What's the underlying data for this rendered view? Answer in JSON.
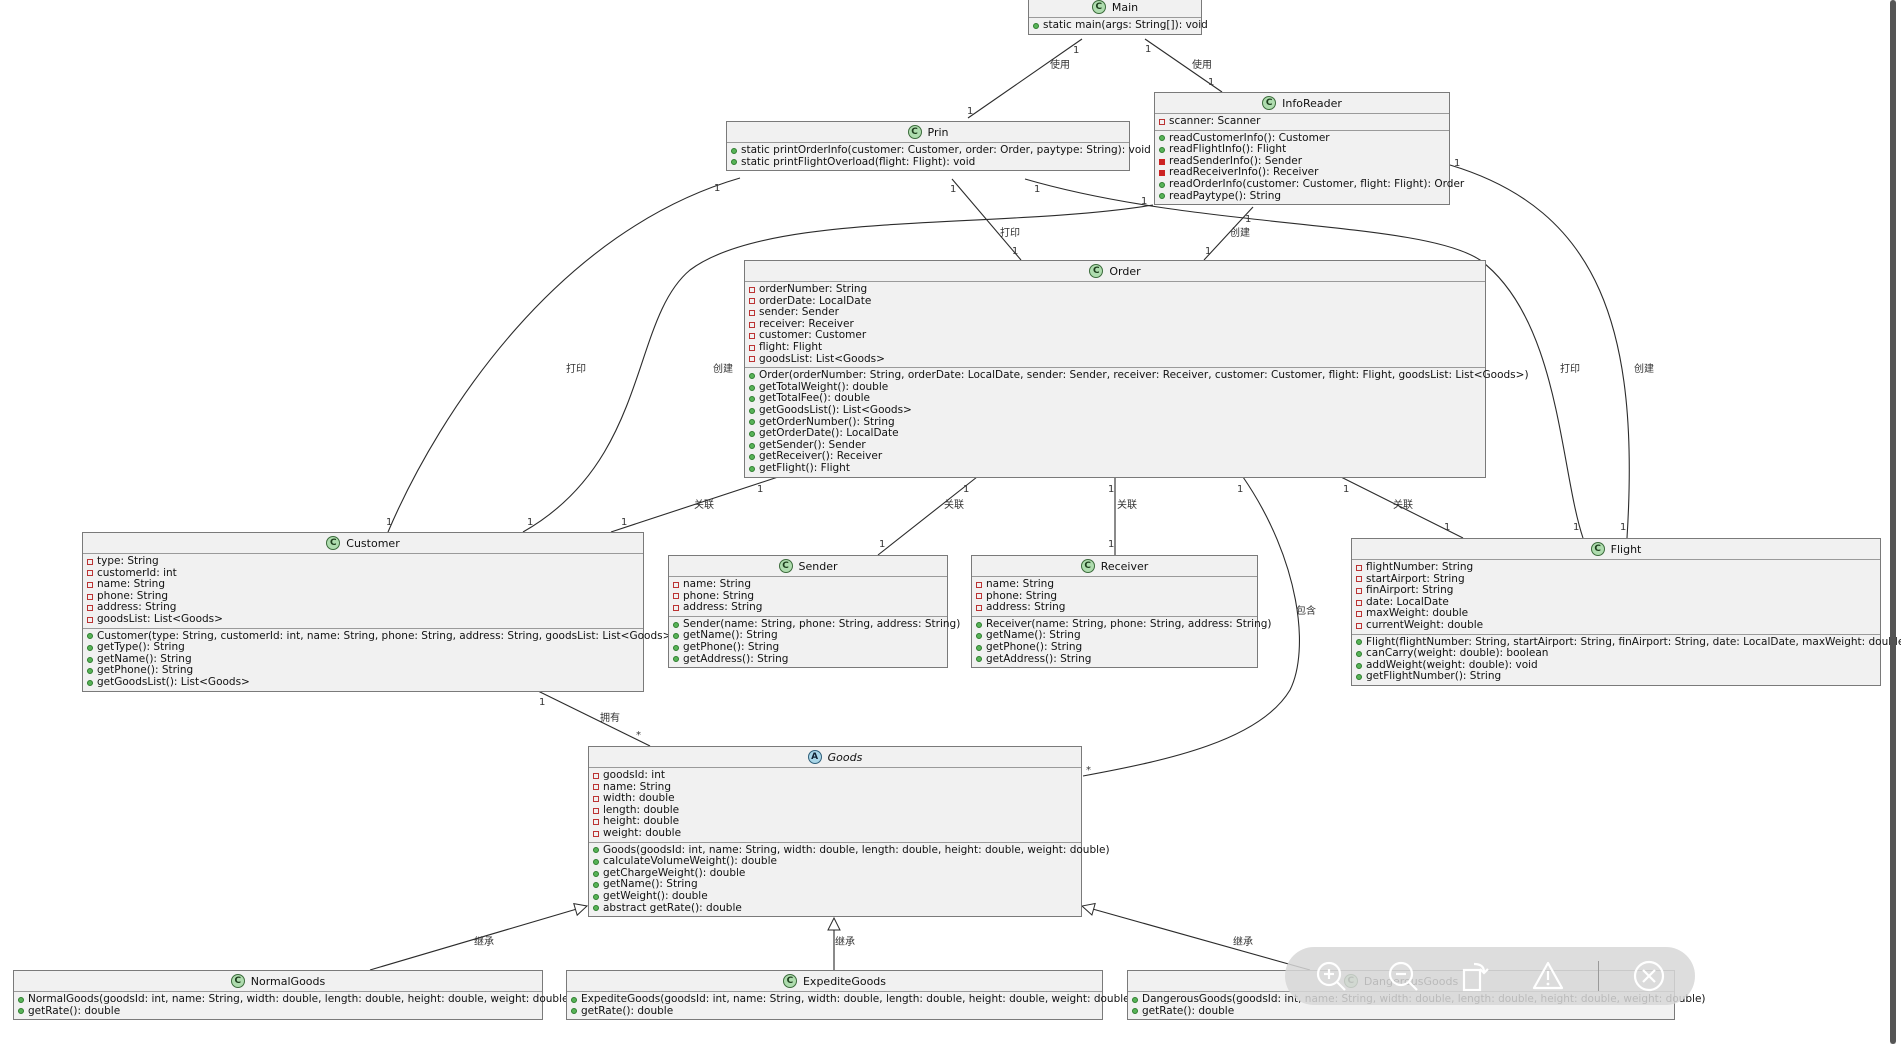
{
  "classes": {
    "main": {
      "name": "Main",
      "stereo": "C",
      "attributes": [],
      "methods": [
        {
          "v": "pub",
          "t": "static main(args: String[]): void"
        }
      ]
    },
    "infoReader": {
      "name": "InfoReader",
      "stereo": "C",
      "attributes": [
        {
          "v": "priv",
          "t": "scanner: Scanner"
        }
      ],
      "methods": [
        {
          "v": "pub",
          "t": "readCustomerInfo(): Customer"
        },
        {
          "v": "pub",
          "t": "readFlightInfo(): Flight"
        },
        {
          "v": "privm",
          "t": "readSenderInfo(): Sender"
        },
        {
          "v": "privm",
          "t": "readReceiverInfo(): Receiver"
        },
        {
          "v": "pub",
          "t": "readOrderInfo(customer: Customer, flight: Flight): Order"
        },
        {
          "v": "pub",
          "t": "readPaytype(): String"
        }
      ]
    },
    "prin": {
      "name": "Prin",
      "stereo": "C",
      "attributes": [],
      "methods": [
        {
          "v": "pub",
          "t": "static printOrderInfo(customer: Customer, order: Order, paytype: String): void"
        },
        {
          "v": "pub",
          "t": "static printFlightOverload(flight: Flight): void"
        }
      ]
    },
    "order": {
      "name": "Order",
      "stereo": "C",
      "attributes": [
        {
          "v": "priv",
          "t": "orderNumber: String"
        },
        {
          "v": "priv",
          "t": "orderDate: LocalDate"
        },
        {
          "v": "priv",
          "t": "sender: Sender"
        },
        {
          "v": "priv",
          "t": "receiver: Receiver"
        },
        {
          "v": "priv",
          "t": "customer: Customer"
        },
        {
          "v": "priv",
          "t": "flight: Flight"
        },
        {
          "v": "priv",
          "t": "goodsList: List<Goods>"
        }
      ],
      "methods": [
        {
          "v": "pub",
          "t": "Order(orderNumber: String, orderDate: LocalDate, sender: Sender, receiver: Receiver, customer: Customer, flight: Flight, goodsList: List<Goods>)"
        },
        {
          "v": "pub",
          "t": "getTotalWeight(): double"
        },
        {
          "v": "pub",
          "t": "getTotalFee(): double"
        },
        {
          "v": "pub",
          "t": "getGoodsList(): List<Goods>"
        },
        {
          "v": "pub",
          "t": "getOrderNumber(): String"
        },
        {
          "v": "pub",
          "t": "getOrderDate(): LocalDate"
        },
        {
          "v": "pub",
          "t": "getSender(): Sender"
        },
        {
          "v": "pub",
          "t": "getReceiver(): Receiver"
        },
        {
          "v": "pub",
          "t": "getFlight(): Flight"
        }
      ]
    },
    "customer": {
      "name": "Customer",
      "stereo": "C",
      "attributes": [
        {
          "v": "priv",
          "t": "type: String"
        },
        {
          "v": "priv",
          "t": "customerId: int"
        },
        {
          "v": "priv",
          "t": "name: String"
        },
        {
          "v": "priv",
          "t": "phone: String"
        },
        {
          "v": "priv",
          "t": "address: String"
        },
        {
          "v": "priv",
          "t": "goodsList: List<Goods>"
        }
      ],
      "methods": [
        {
          "v": "pub",
          "t": "Customer(type: String, customerId: int, name: String, phone: String, address: String, goodsList: List<Goods>)"
        },
        {
          "v": "pub",
          "t": "getType(): String"
        },
        {
          "v": "pub",
          "t": "getName(): String"
        },
        {
          "v": "pub",
          "t": "getPhone(): String"
        },
        {
          "v": "pub",
          "t": "getGoodsList(): List<Goods>"
        }
      ]
    },
    "sender": {
      "name": "Sender",
      "stereo": "C",
      "attributes": [
        {
          "v": "priv",
          "t": "name: String"
        },
        {
          "v": "priv",
          "t": "phone: String"
        },
        {
          "v": "priv",
          "t": "address: String"
        }
      ],
      "methods": [
        {
          "v": "pub",
          "t": "Sender(name: String, phone: String, address: String)"
        },
        {
          "v": "pub",
          "t": "getName(): String"
        },
        {
          "v": "pub",
          "t": "getPhone(): String"
        },
        {
          "v": "pub",
          "t": "getAddress(): String"
        }
      ]
    },
    "receiver": {
      "name": "Receiver",
      "stereo": "C",
      "attributes": [
        {
          "v": "priv",
          "t": "name: String"
        },
        {
          "v": "priv",
          "t": "phone: String"
        },
        {
          "v": "priv",
          "t": "address: String"
        }
      ],
      "methods": [
        {
          "v": "pub",
          "t": "Receiver(name: String, phone: String, address: String)"
        },
        {
          "v": "pub",
          "t": "getName(): String"
        },
        {
          "v": "pub",
          "t": "getPhone(): String"
        },
        {
          "v": "pub",
          "t": "getAddress(): String"
        }
      ]
    },
    "flight": {
      "name": "Flight",
      "stereo": "C",
      "attributes": [
        {
          "v": "priv",
          "t": "flightNumber: String"
        },
        {
          "v": "priv",
          "t": "startAirport: String"
        },
        {
          "v": "priv",
          "t": "finAirport: String"
        },
        {
          "v": "priv",
          "t": "date: LocalDate"
        },
        {
          "v": "priv",
          "t": "maxWeight: double"
        },
        {
          "v": "priv",
          "t": "currentWeight: double"
        }
      ],
      "methods": [
        {
          "v": "pub",
          "t": "Flight(flightNumber: String, startAirport: String, finAirport: String, date: LocalDate, maxWeight: double)"
        },
        {
          "v": "pub",
          "t": "canCarry(weight: double): boolean"
        },
        {
          "v": "pub",
          "t": "addWeight(weight: double): void"
        },
        {
          "v": "pub",
          "t": "getFlightNumber(): String"
        }
      ]
    },
    "goods": {
      "name": "Goods",
      "stereo": "A",
      "abstract": true,
      "attributes": [
        {
          "v": "priv",
          "t": "goodsId: int"
        },
        {
          "v": "priv",
          "t": "name: String"
        },
        {
          "v": "priv",
          "t": "width: double"
        },
        {
          "v": "priv",
          "t": "length: double"
        },
        {
          "v": "priv",
          "t": "height: double"
        },
        {
          "v": "priv",
          "t": "weight: double"
        }
      ],
      "methods": [
        {
          "v": "pub",
          "t": "Goods(goodsId: int, name: String, width: double, length: double, height: double, weight: double)"
        },
        {
          "v": "pub",
          "t": "calculateVolumeWeight(): double"
        },
        {
          "v": "pub",
          "t": "getChargeWeight(): double"
        },
        {
          "v": "pub",
          "t": "getName(): String"
        },
        {
          "v": "pub",
          "t": "getWeight(): double"
        },
        {
          "v": "pub",
          "t": "abstract getRate(): double"
        }
      ]
    },
    "normalGoods": {
      "name": "NormalGoods",
      "stereo": "C",
      "attributes": [],
      "methods": [
        {
          "v": "pub",
          "t": "NormalGoods(goodsId: int, name: String, width: double, length: double, height: double, weight: double)"
        },
        {
          "v": "pub",
          "t": "getRate(): double"
        }
      ]
    },
    "expediteGoods": {
      "name": "ExpediteGoods",
      "stereo": "C",
      "attributes": [],
      "methods": [
        {
          "v": "pub",
          "t": "ExpediteGoods(goodsId: int, name: String, width: double, length: double, height: double, weight: double)"
        },
        {
          "v": "pub",
          "t": "getRate(): double"
        }
      ]
    },
    "dangerousGoods": {
      "name": "DangerousGoods",
      "stereo": "C",
      "attributes": [],
      "methods": [
        {
          "v": "pub",
          "t": "DangerousGoods(goodsId: int, name: String, width: double, length: double, height: double, weight: double)"
        },
        {
          "v": "pub",
          "t": "getRate(): double"
        }
      ]
    }
  },
  "edge_labels": {
    "use": "使用",
    "print": "打印",
    "create": "创建",
    "assoc": "关联",
    "own": "拥有",
    "contain": "包含",
    "inherit": "继承",
    "one": "1",
    "many": "*"
  },
  "toolbar": {
    "buttons": [
      {
        "icon": "zoom-in-icon"
      },
      {
        "icon": "zoom-out-icon"
      },
      {
        "icon": "rotate-icon"
      },
      {
        "icon": "report-icon"
      },
      {
        "icon": "close-icon"
      }
    ]
  }
}
